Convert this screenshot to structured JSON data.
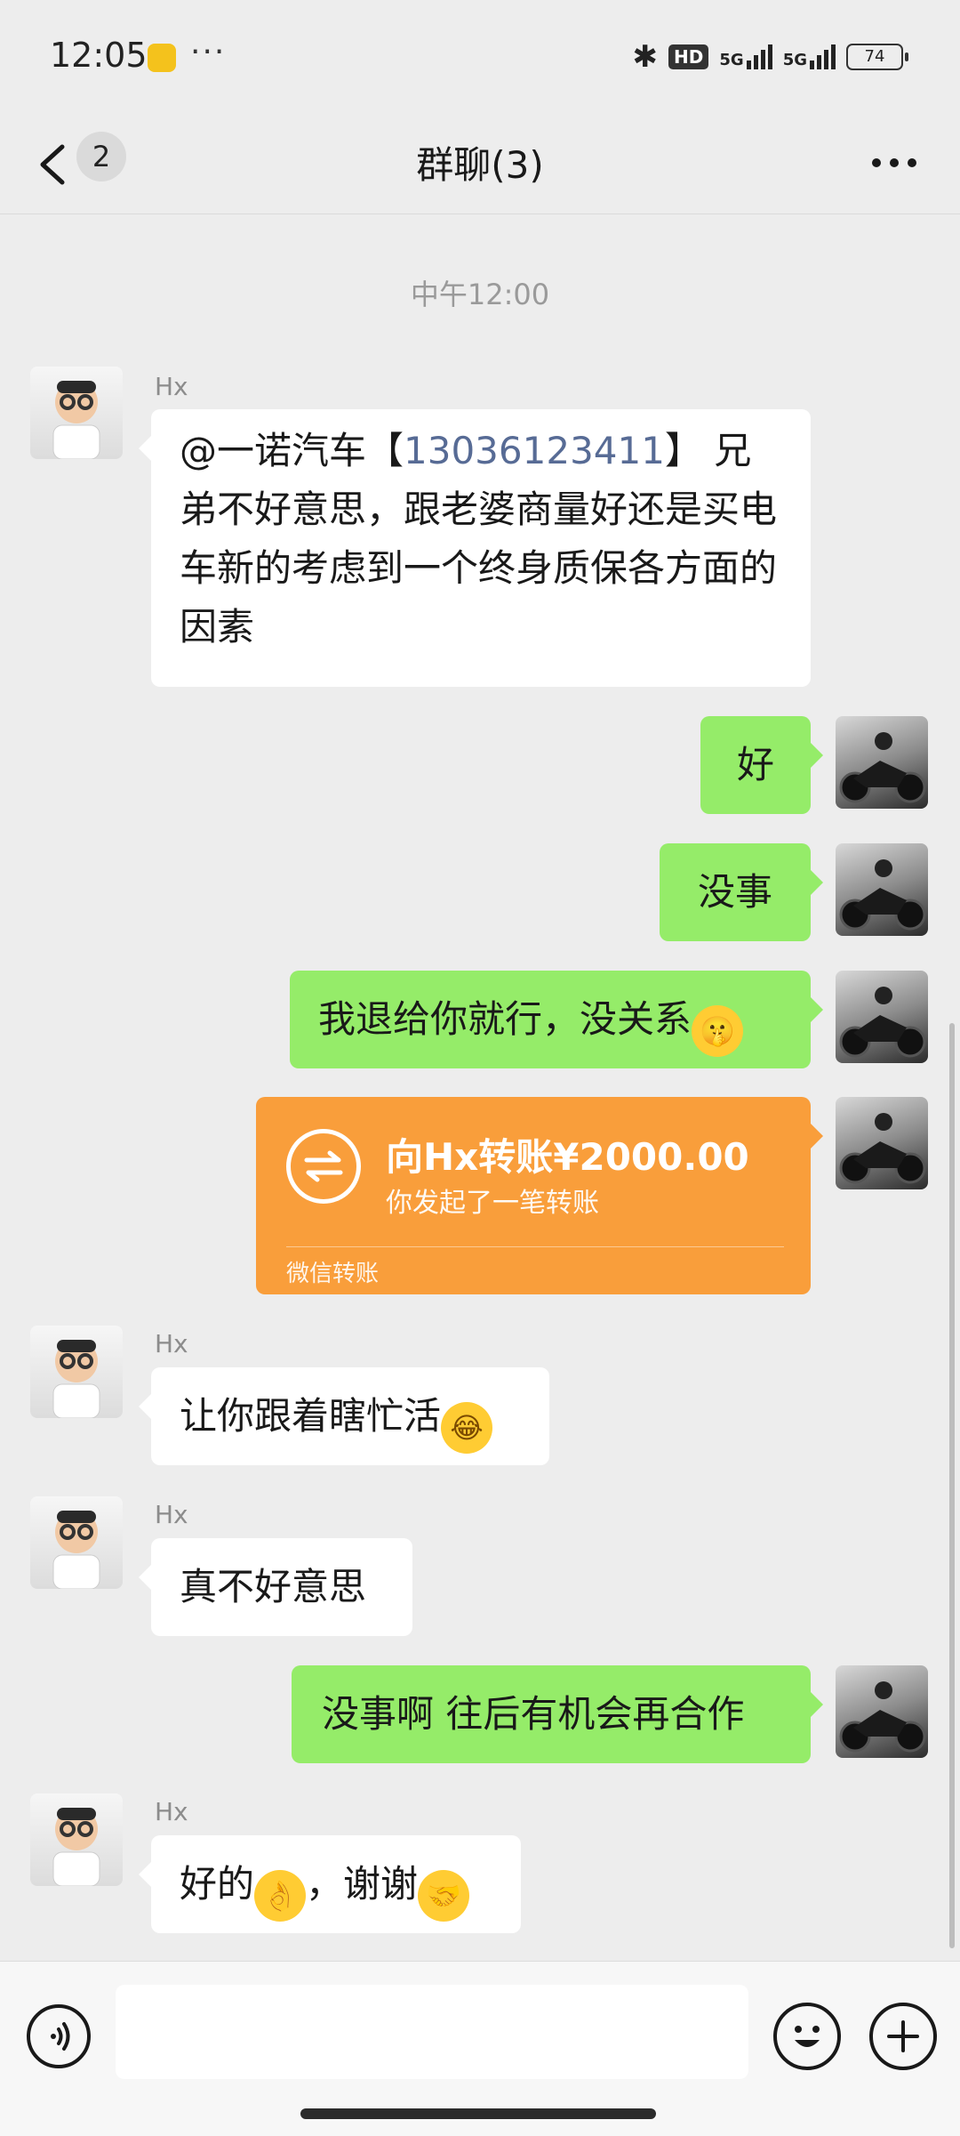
{
  "status_bar": {
    "time": "12:05",
    "more": "···",
    "hd": "HD",
    "net1": "5G",
    "net2": "5G",
    "battery": "74"
  },
  "header": {
    "unread_count": "2",
    "title": "群聊(3)"
  },
  "chat": {
    "timestamp": "中午12:00",
    "messages": [
      {
        "side": "left",
        "sender": "Hx",
        "text_pre": "@一诺汽车【",
        "mention_phone": "13036123411",
        "text_post": "】 兄弟不好意思，跟老婆商量好还是买电车新的考虑到一个终身质保各方面的因素"
      },
      {
        "side": "right",
        "text": "好"
      },
      {
        "side": "right",
        "text": "没事"
      },
      {
        "side": "right",
        "text": "我退给你就行，没关系"
      },
      {
        "side": "right",
        "type": "transfer",
        "amount_text": "向Hx转账¥2000.00",
        "subtitle": "你发起了一笔转账",
        "footer": "微信转账"
      },
      {
        "side": "left",
        "sender": "Hx",
        "text": "让你跟着瞎忙活"
      },
      {
        "side": "left",
        "sender": "Hx",
        "text": "真不好意思"
      },
      {
        "side": "right",
        "text": "没事啊 往后有机会再合作"
      },
      {
        "side": "left",
        "sender": "Hx",
        "text_a": "好的",
        "text_b": "，谢谢"
      }
    ]
  },
  "icons": {
    "emoji_shush": "shushing-face-emoji",
    "emoji_laugh": "tears-of-joy-emoji",
    "emoji_ok": "ok-hand-emoji",
    "emoji_handshake": "handshake-emoji"
  },
  "colors": {
    "background": "#ededed",
    "bubble_self": "#95ec69",
    "bubble_other": "#ffffff",
    "transfer": "#f99e3b",
    "mention": "#576b95"
  }
}
